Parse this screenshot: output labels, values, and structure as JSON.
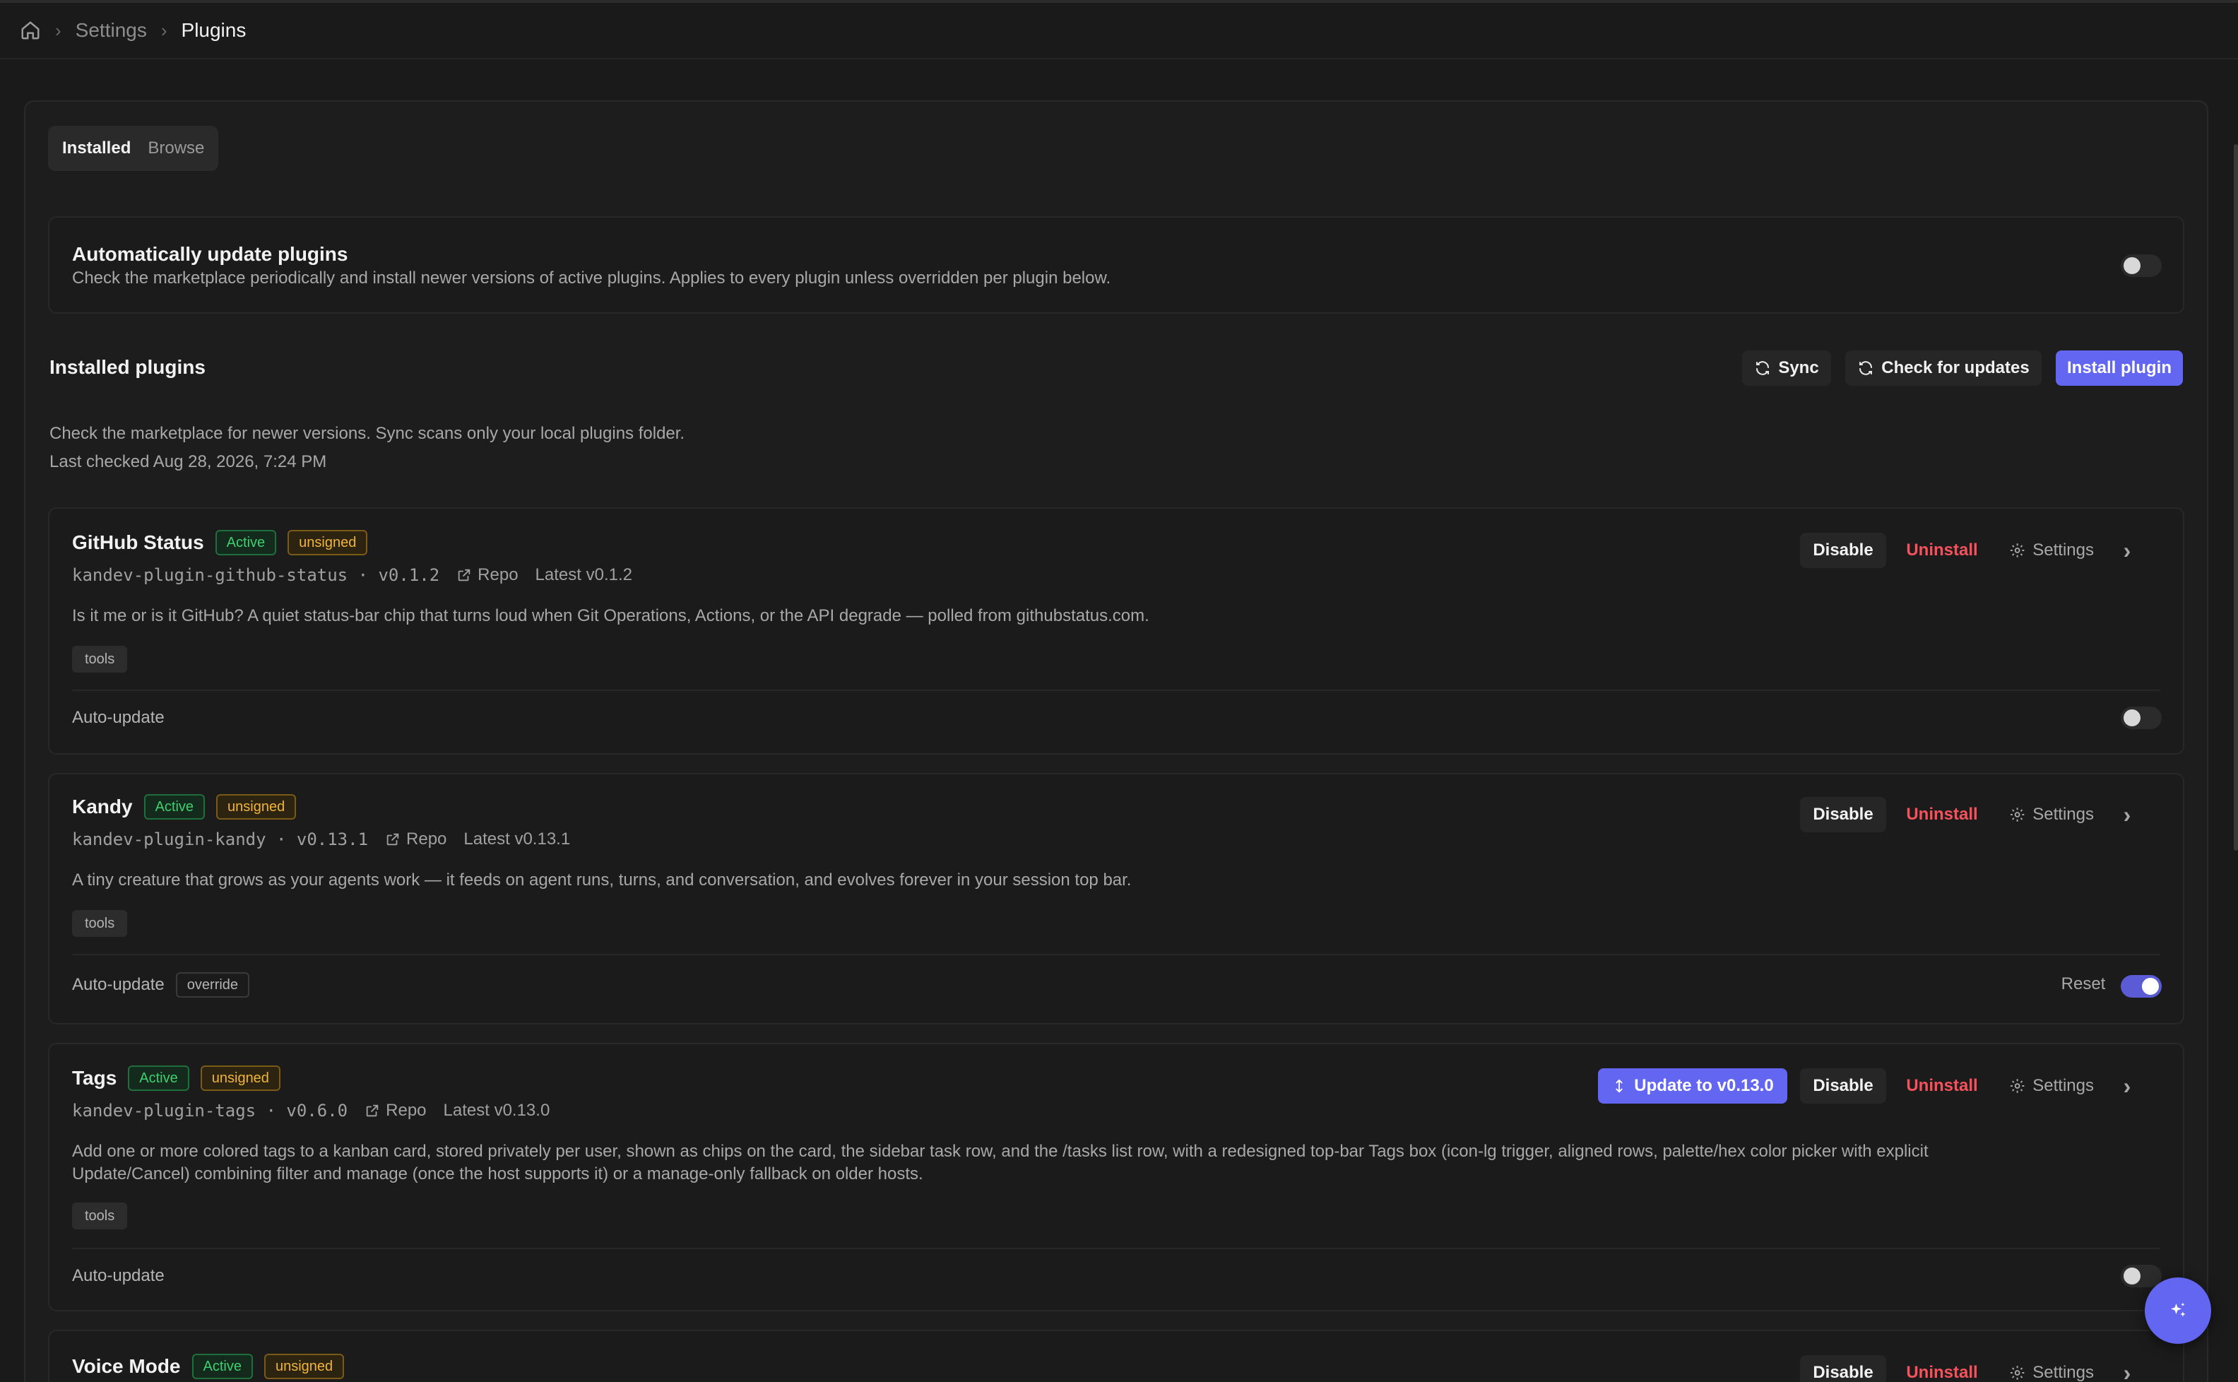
{
  "breadcrumb": {
    "home_icon": "home-icon",
    "settings": "Settings",
    "current": "Plugins"
  },
  "tabs": [
    {
      "label": "Installed",
      "active": true
    },
    {
      "label": "Browse",
      "active": false
    }
  ],
  "auto_update": {
    "title": "Automatically update plugins",
    "description": "Check the marketplace periodically and install newer versions of active plugins. Applies to every plugin unless overridden per plugin below.",
    "enabled": false
  },
  "installed": {
    "heading": "Installed plugins",
    "sync_label": "Sync",
    "check_label": "Check for updates",
    "install_label": "Install plugin",
    "info": "Check the marketplace for newer versions. Sync scans only your local plugins folder.",
    "last_checked": "Last checked Aug 28, 2026, 7:24 PM"
  },
  "labels": {
    "disable": "Disable",
    "uninstall": "Uninstall",
    "settings": "Settings",
    "repo": "Repo",
    "auto_update": "Auto-update",
    "override": "override",
    "reset": "Reset",
    "active": "Active",
    "unsigned": "unsigned"
  },
  "plugins": [
    {
      "name": "GitHub Status",
      "meta": "kandev-plugin-github-status · v0.1.2",
      "latest": "Latest v0.1.2",
      "description": "Is it me or is it GitHub? A quiet status-bar chip that turns loud when Git Operations, Actions, or the API degrade — polled from githubstatus.com.",
      "tag": "tools",
      "auto_update": false
    },
    {
      "name": "Kandy",
      "meta": "kandev-plugin-kandy · v0.13.1",
      "latest": "Latest v0.13.1",
      "description": "A tiny creature that grows as your agents work — it feeds on agent runs, turns, and conversation, and evolves forever in your session top bar.",
      "tag": "tools",
      "auto_update": true
    },
    {
      "name": "Tags",
      "meta": "kandev-plugin-tags · v0.6.0",
      "latest": "Latest v0.13.0",
      "update_label": "Update to v0.13.0",
      "description_line1": "Add one or more colored tags to a kanban card, stored privately per user, shown as chips on the card, the sidebar task row, and the /tasks list row, with a redesigned top-bar Tags box (icon-lg trigger, aligned rows, palette/hex color picker with explicit",
      "description_line2": "Update/Cancel) combining filter and manage (once the host supports it) or a manage-only fallback on older hosts.",
      "tag": "tools",
      "auto_update": false
    },
    {
      "name": "Voice Mode"
    }
  ],
  "colors": {
    "accent": "#6366f1",
    "danger": "#f4525c",
    "active": "#3fcf6e",
    "unsigned": "#f0b43a"
  }
}
